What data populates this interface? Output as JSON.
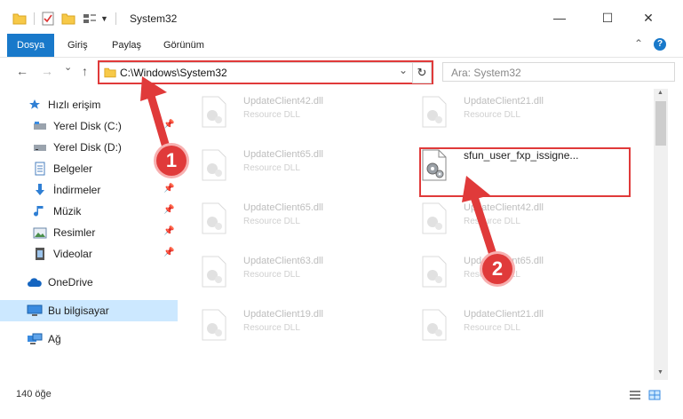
{
  "window": {
    "title": "System32",
    "minimize": "—",
    "maximize": "☐",
    "close": "✕",
    "collapse": "⌃",
    "help": "?"
  },
  "ribbon": {
    "tabs": [
      "Dosya",
      "Giriş",
      "Paylaş",
      "Görünüm"
    ]
  },
  "nav": {
    "back": "←",
    "forward": "→",
    "dropdown": "⌄",
    "up": "↑",
    "address": "C:\\Windows\\System32",
    "address_dropdown": "⌄",
    "refresh": "↻",
    "search_placeholder": "Ara: System32"
  },
  "sidebar": {
    "items": [
      {
        "label": "Hızlı erişim",
        "icon": "star-icon",
        "pinned": false
      },
      {
        "label": "Yerel Disk (C:)",
        "icon": "drive-icon",
        "pinned": true
      },
      {
        "label": "Yerel Disk (D:)",
        "icon": "drive-icon",
        "pinned": false
      },
      {
        "label": "Belgeler",
        "icon": "documents-icon",
        "pinned": true
      },
      {
        "label": "İndirmeler",
        "icon": "download-icon",
        "pinned": true
      },
      {
        "label": "Müzik",
        "icon": "music-icon",
        "pinned": true
      },
      {
        "label": "Resimler",
        "icon": "pictures-icon",
        "pinned": true
      },
      {
        "label": "Videolar",
        "icon": "videos-icon",
        "pinned": true
      },
      {
        "label": "OneDrive",
        "icon": "cloud-icon",
        "pinned": false
      },
      {
        "label": "Bu bilgisayar",
        "icon": "computer-icon",
        "pinned": false
      },
      {
        "label": "Ağ",
        "icon": "network-icon",
        "pinned": false
      }
    ]
  },
  "files": [
    {
      "name": "UpdateClient42.dll",
      "type": "Resource DLL"
    },
    {
      "name": "UpdateClient21.dll",
      "type": "Resource DLL"
    },
    {
      "name": "UpdateClient65.dll",
      "type": "Resource DLL"
    },
    {
      "name": "sfun_user_fxp_issigne...",
      "type": ""
    },
    {
      "name": "UpdateClient65.dll",
      "type": "Resource DLL"
    },
    {
      "name": "UpdateClient42.dll",
      "type": "Resource DLL"
    },
    {
      "name": "UpdateClient63.dll",
      "type": "Resource DLL"
    },
    {
      "name": "UpdateClient65.dll",
      "type": "Resource DLL"
    },
    {
      "name": "UpdateClient19.dll",
      "type": "Resource DLL"
    },
    {
      "name": "UpdateClient21.dll",
      "type": "Resource DLL"
    }
  ],
  "status": {
    "count": "140 öğe"
  },
  "annotations": {
    "step1": "1",
    "step2": "2"
  },
  "colors": {
    "accent": "#1979ca",
    "annotation": "#e03a3a",
    "selected": "#cce8ff"
  }
}
